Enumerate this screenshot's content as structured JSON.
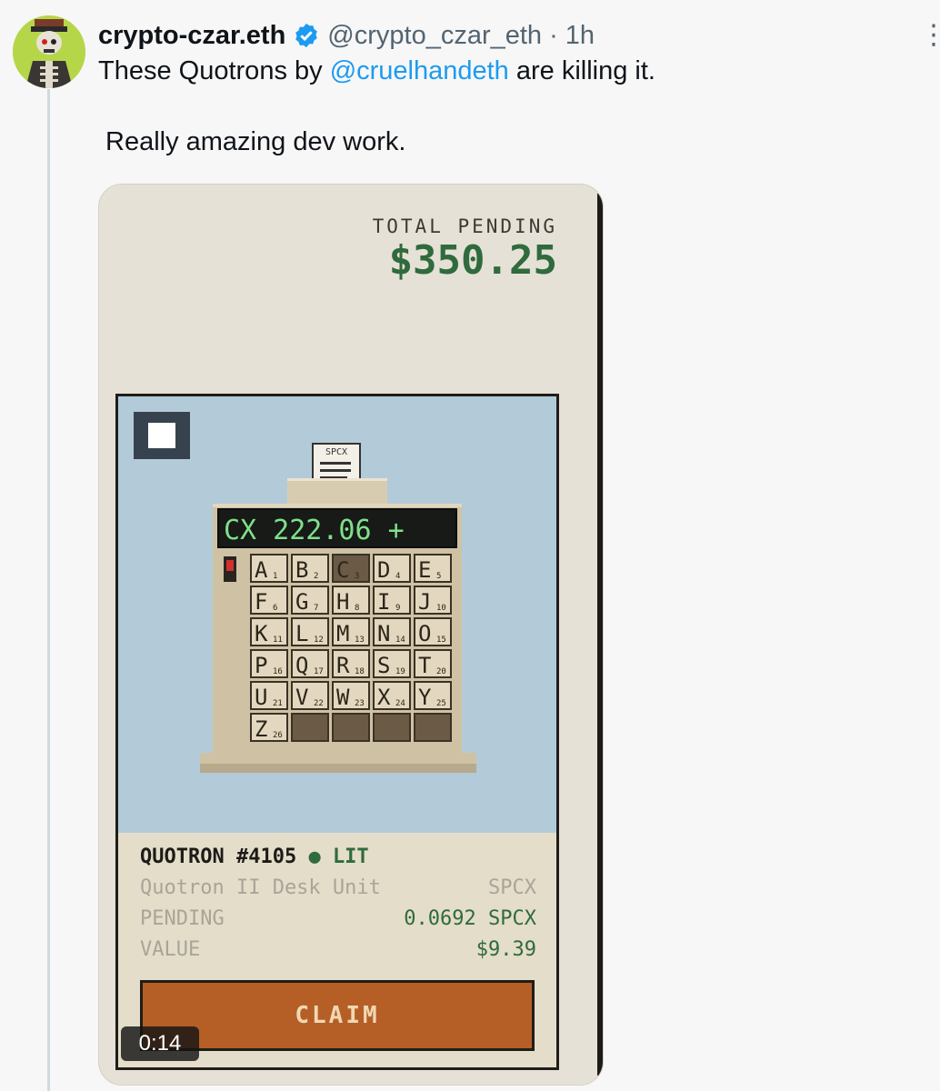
{
  "tweet": {
    "display_name": "crypto-czar.eth",
    "handle": "@crypto_czar_eth",
    "separator": "·",
    "time": "1h",
    "text_before": "These Quotrons by ",
    "mention": "@cruelhandeth",
    "text_after": " are killing it.",
    "second_line": "Really amazing dev work."
  },
  "media": {
    "total_label": "TOTAL PENDING",
    "total_value": "$350.25",
    "paper_label": "SPCX",
    "display": "CX 222.06 +",
    "keys": [
      {
        "letter": "A",
        "num": "1"
      },
      {
        "letter": "B",
        "num": "2"
      },
      {
        "letter": "C",
        "num": "3"
      },
      {
        "letter": "D",
        "num": "4"
      },
      {
        "letter": "E",
        "num": "5"
      },
      {
        "letter": "F",
        "num": "6"
      },
      {
        "letter": "G",
        "num": "7"
      },
      {
        "letter": "H",
        "num": "8"
      },
      {
        "letter": "I",
        "num": "9"
      },
      {
        "letter": "J",
        "num": "10"
      },
      {
        "letter": "K",
        "num": "11"
      },
      {
        "letter": "L",
        "num": "12"
      },
      {
        "letter": "M",
        "num": "13"
      },
      {
        "letter": "N",
        "num": "14"
      },
      {
        "letter": "O",
        "num": "15"
      },
      {
        "letter": "P",
        "num": "16"
      },
      {
        "letter": "Q",
        "num": "17"
      },
      {
        "letter": "R",
        "num": "18"
      },
      {
        "letter": "S",
        "num": "19"
      },
      {
        "letter": "T",
        "num": "20"
      },
      {
        "letter": "U",
        "num": "21"
      },
      {
        "letter": "V",
        "num": "22"
      },
      {
        "letter": "W",
        "num": "23"
      },
      {
        "letter": "X",
        "num": "24"
      },
      {
        "letter": "Y",
        "num": "25"
      },
      {
        "letter": "Z",
        "num": "26"
      },
      {
        "letter": "",
        "num": ""
      },
      {
        "letter": "",
        "num": ""
      },
      {
        "letter": "",
        "num": ""
      },
      {
        "letter": "",
        "num": ""
      }
    ],
    "card_title": "QUOTRON #4105",
    "status_dot": "●",
    "status": "LIT",
    "model": "Quotron II Desk Unit",
    "ticker": "SPCX",
    "pending_label": "PENDING",
    "pending_value": "0.0692 SPCX",
    "value_label": "VALUE",
    "value_value": "$9.39",
    "claim_label": "CLAIM",
    "video_time": "0:14"
  }
}
